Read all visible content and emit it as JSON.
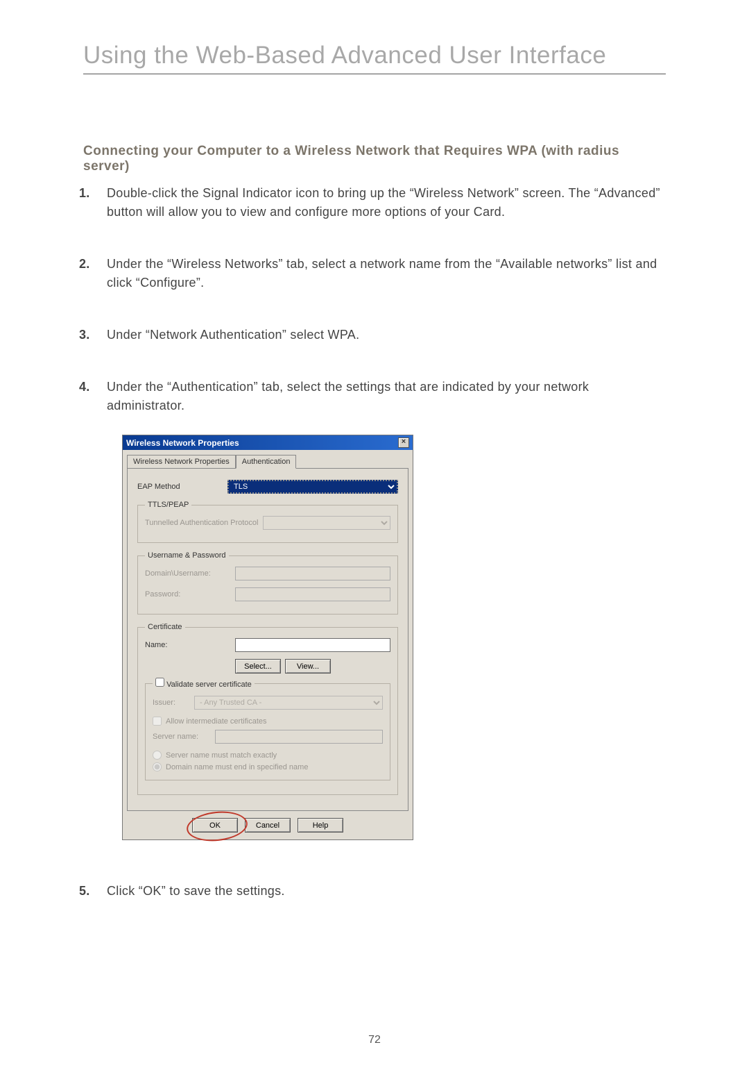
{
  "page": {
    "title": "Using the Web-Based Advanced User Interface",
    "section_heading": "Connecting your Computer to a Wireless Network that Requires WPA (with radius server)",
    "page_number": "72"
  },
  "steps": [
    {
      "num": "1.",
      "text": "Double-click the Signal Indicator icon to bring up the “Wireless Network” screen. The “Advanced” button will allow you to view and configure more options of your Card."
    },
    {
      "num": "2.",
      "text": "Under the “Wireless Networks” tab, select a network name from the “Available networks” list and click “Configure”."
    },
    {
      "num": "3.",
      "text": "Under “Network Authentication” select WPA."
    },
    {
      "num": "4.",
      "text": "Under the “Authentication” tab, select the settings that are indicated by your network administrator."
    },
    {
      "num": "5.",
      "text": "Click “OK” to save the settings."
    }
  ],
  "dialog": {
    "title": "Wireless Network Properties",
    "tabs": {
      "tab1": "Wireless Network Properties",
      "tab2": "Authentication"
    },
    "eap_label": "EAP Method",
    "eap_value": "TLS",
    "ttls_group": "TTLS/PEAP",
    "tap_label": "Tunnelled Authentication Protocol",
    "tap_value": "",
    "up_group": "Username & Password",
    "domain_user_label": "Domain\\Username:",
    "password_label": "Password:",
    "cert_group": "Certificate",
    "cert_name_label": "Name:",
    "select_btn": "Select...",
    "view_btn": "View...",
    "validate_label": "Validate server certificate",
    "issuer_label": "Issuer:",
    "issuer_value": "- Any Trusted CA -",
    "allow_intermediate_label": "Allow intermediate certificates",
    "server_name_label": "Server name:",
    "radio_exact": "Server name must match exactly",
    "radio_domain": "Domain name must end in specified name",
    "ok_btn": "OK",
    "cancel_btn": "Cancel",
    "help_btn": "Help"
  }
}
